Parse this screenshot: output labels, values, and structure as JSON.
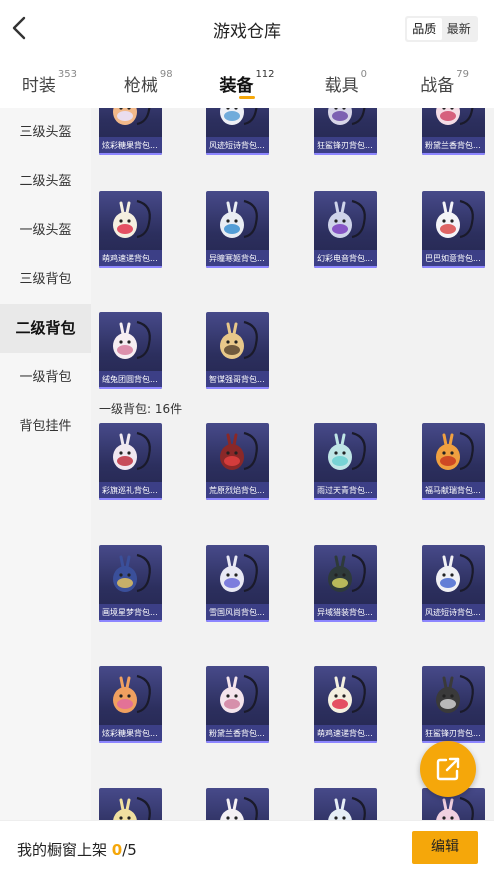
{
  "header": {
    "title": "游戏仓库",
    "sort_options": [
      "品质",
      "最新"
    ],
    "sort_active": 0
  },
  "tabs": [
    {
      "label": "时装",
      "count": "353"
    },
    {
      "label": "枪械",
      "count": "98"
    },
    {
      "label": "装备",
      "count": "112"
    },
    {
      "label": "载具",
      "count": "0"
    },
    {
      "label": "战备",
      "count": "79"
    }
  ],
  "active_tab": 2,
  "sidebar": {
    "items": [
      "三级头盔",
      "二级头盔",
      "一级头盔",
      "三级背包",
      "二级背包",
      "一级背包",
      "背包挂件"
    ],
    "active": 4
  },
  "grid": {
    "section_title": "一级背包: 16件",
    "rows": [
      [
        "炫彩糖果背包...",
        "风迹短诗背包...",
        "狂鲨锋刃背包...",
        "粉黛兰香背包..."
      ],
      [
        "萌鸡速递背包...",
        "异瞳寒姬背包...",
        "幻彩电音背包...",
        "巴巴如意背包..."
      ],
      [
        "绒兔团圆背包...",
        "智谋强哥背包..."
      ],
      [
        "彩旗巡礼背包...",
        "荒原烈焰背包...",
        "雨过天青背包...",
        "福马献瑞背包..."
      ],
      [
        "画境星梦背包...",
        "雪国风尚背包...",
        "异域猎装背包...",
        "风迹短诗背包..."
      ],
      [
        "炫彩糖果背包...",
        "粉黛兰香背包...",
        "萌鸡速递背包...",
        "狂鲨锋刃背包..."
      ],
      [
        "",
        "",
        "",
        ""
      ]
    ]
  },
  "colors": {
    "accent": "#f5a70a",
    "card_top": "#474a8a",
    "card_bottom": "#24264f",
    "caption_bg": "#3c3f86"
  },
  "footer": {
    "shelf_label": "我的橱窗上架",
    "shelf_count": "0",
    "shelf_total": "/5",
    "edit_label": "编辑"
  },
  "icons": {
    "back": "chevron-left-icon",
    "share": "external-link-icon",
    "item": "backpack-icon"
  }
}
